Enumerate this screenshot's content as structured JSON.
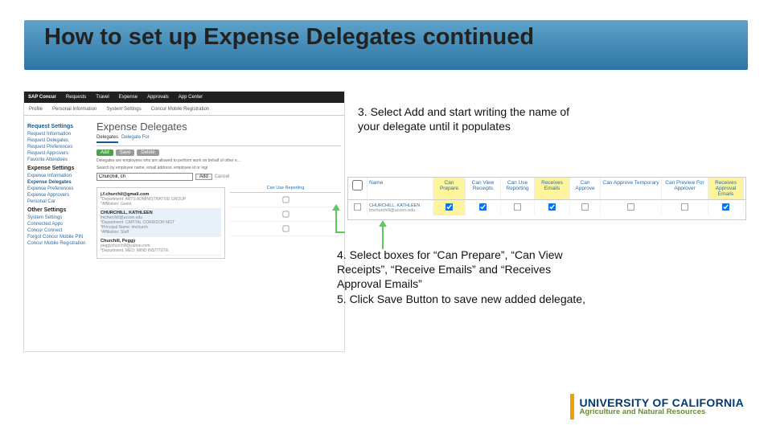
{
  "title": "How to set up Expense Delegates continued",
  "instruction1": "3. Select Add and start writing the name of your delegate until it populates",
  "instruction2": "4. Select boxes for “Can Prepare”, “Can View Receipts”, “Receive Emails” and “Receives Approval Emails”\n5. Click Save Button to save new added delegate,",
  "concur": {
    "brand": "SAP Concur",
    "nav": [
      "Requests",
      "Travel",
      "Expense",
      "Approvals",
      "App Center"
    ],
    "subnav": [
      "Profile",
      "Personal Information",
      "System Settings",
      "Concur Mobile Registration"
    ],
    "side": {
      "request_h": "Request Settings",
      "request_items": [
        "Request Information",
        "Request Delegates",
        "Request Preferences",
        "Request Approvers",
        "Favorite Attendees"
      ],
      "expense_h": "Expense Settings",
      "expense_items": [
        "Expense Information",
        "Expense Delegates",
        "Expense Preferences",
        "Expense Approvers",
        "Personal Car"
      ],
      "other_h": "Other Settings",
      "other_items": [
        "System Settings",
        "Connected Apps",
        "Concur Connect",
        "Forgot Concur Mobile PIN",
        "Concur Mobile Registration"
      ]
    },
    "main": {
      "heading": "Expense Delegates",
      "tabs": [
        "Delegates",
        "Delegate For"
      ],
      "buttons": {
        "add": "Add",
        "save": "Save",
        "delete": "Delete",
        "addsmall": "Add",
        "cancel": "Cancel"
      },
      "note": "Delegates are employees who are allowed to perform work on behalf of other e...",
      "search_label": "Search by employee name, email address, employee id or logi",
      "search_value": "Churchill, ch",
      "columns": [
        "Can Use Reporting"
      ],
      "dropdown": [
        {
          "name": "j.f.churchil@gmail.com",
          "line2": "*Department: ARTS ADMINISTRATIVE GROUP",
          "line3": "*Affiliation: Guest"
        },
        {
          "name": "CHURCHILL, KATHLEEN",
          "line2": "lmchurchill@uconn.edu",
          "line3": "*Department: CAPITAL CORRIDOR MGT",
          "line4": "*Principal Name: lmchurch",
          "line5": "*Affiliation: Staff"
        },
        {
          "name": "Churchill, Peggy",
          "line2": "peggychurchill@yahoo.com",
          "line3": "*Department: MED: MIND INSTITUTE"
        }
      ]
    }
  },
  "table": {
    "headers": [
      "",
      "Name",
      "Can Prepare",
      "Can View Receipts",
      "Can Use Reporting",
      "Receives Emails",
      "Can Approve",
      "Can Approve Temporary",
      "Can Preview For Approver",
      "Receives Approval Emails"
    ],
    "highlight": [
      false,
      false,
      true,
      false,
      false,
      true,
      false,
      false,
      false,
      true
    ],
    "row": {
      "name": "CHURCHILL, KATHLEEN",
      "email": "lmchurchill@uconn.edu",
      "checked": [
        false,
        true,
        true,
        false,
        true,
        false,
        false,
        false,
        true
      ]
    }
  },
  "footer": {
    "main": "UNIVERSITY OF CALIFORNIA",
    "sub": "Agriculture and Natural Resources"
  }
}
